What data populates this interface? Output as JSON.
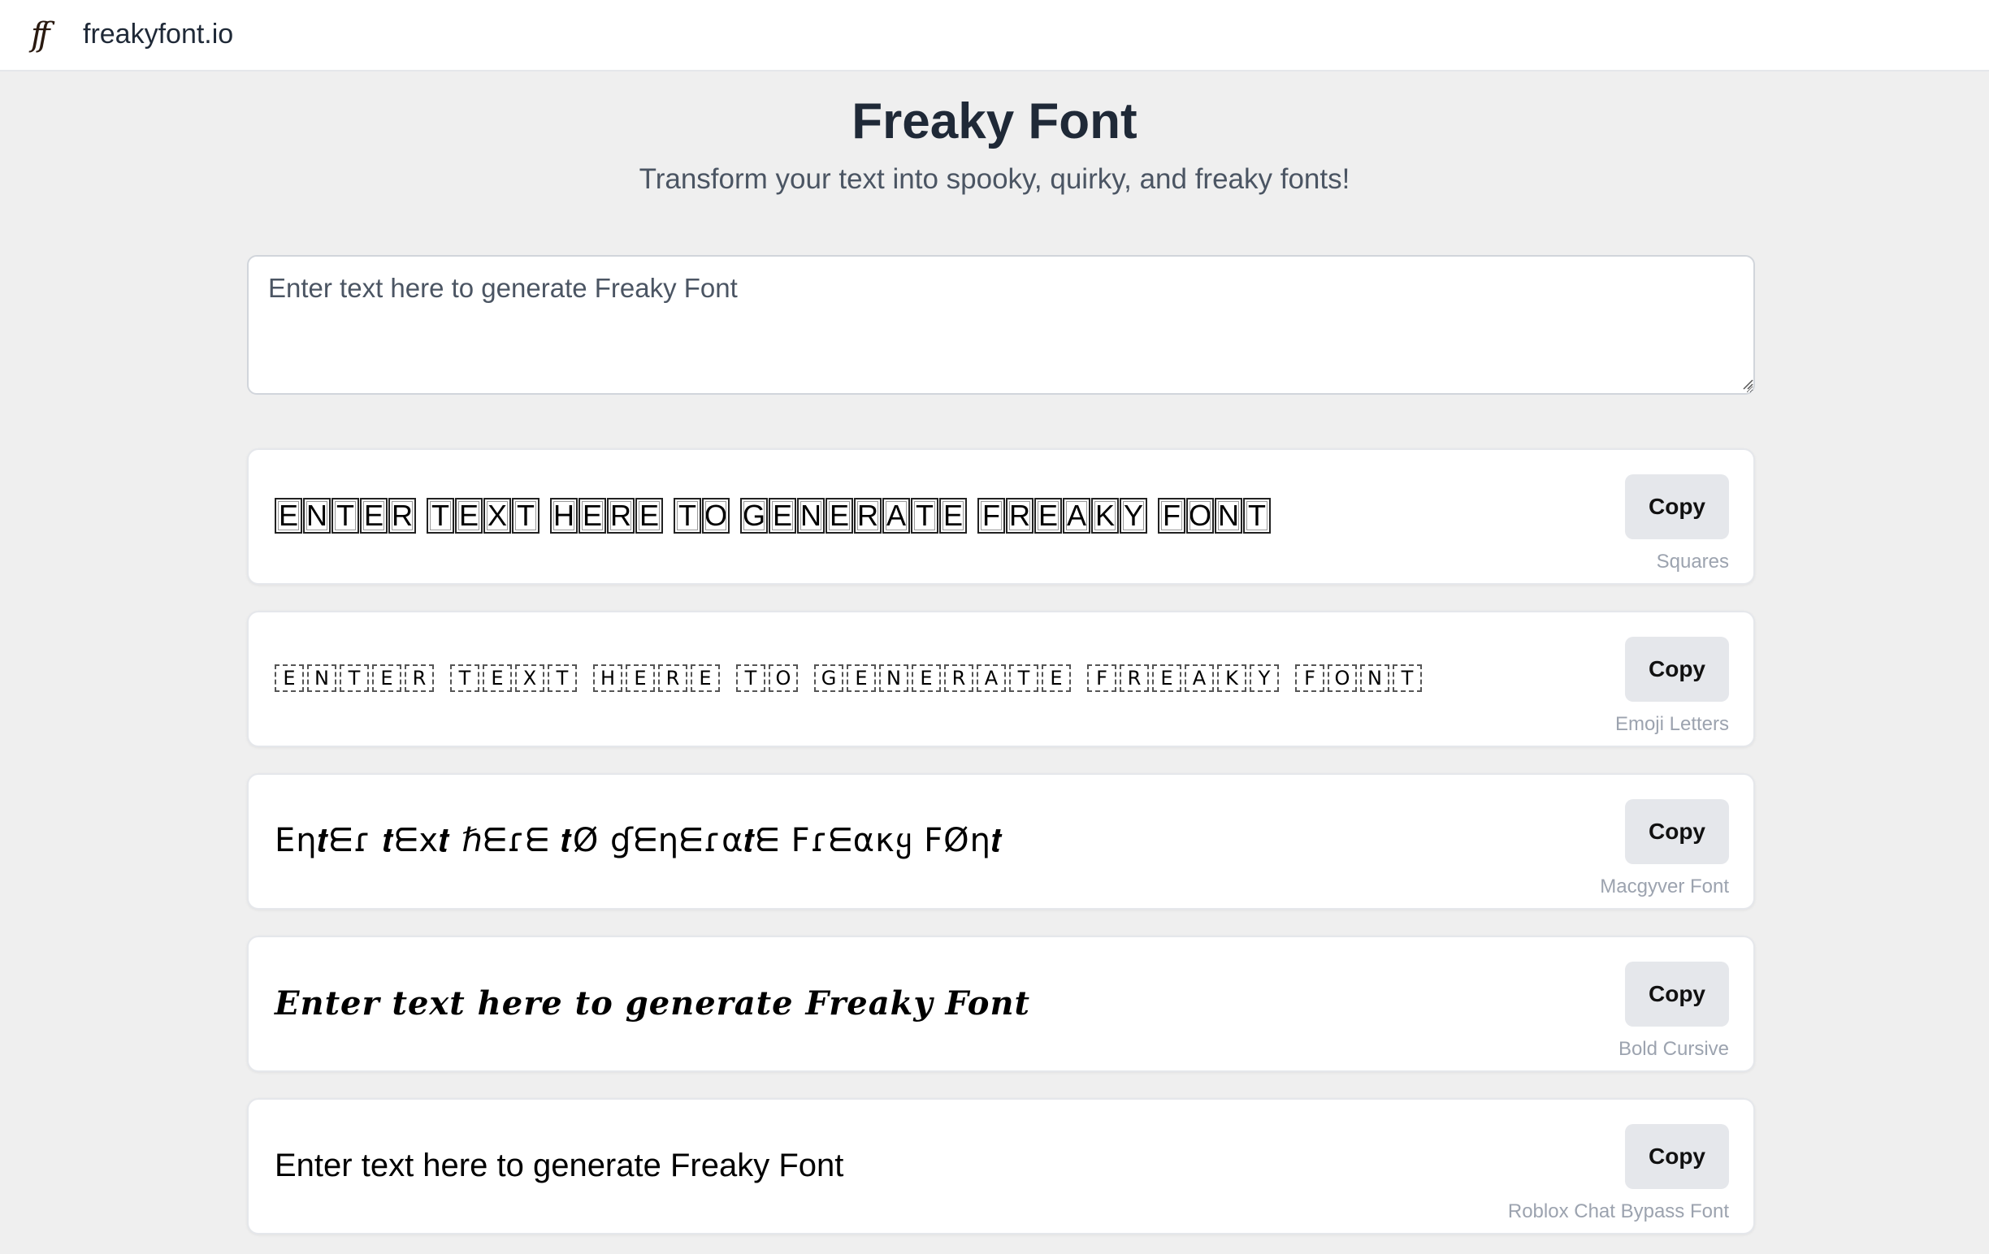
{
  "header": {
    "logo_glyph": "ff",
    "brand": "freakyfont.io"
  },
  "hero": {
    "title": "Freaky Font",
    "subtitle": "Transform your text into spooky, quirky, and freaky fonts!"
  },
  "input": {
    "value": "",
    "placeholder": "Enter text here to generate Freaky Font"
  },
  "source_text": "Enter text here to generate Freaky Font",
  "results": [
    {
      "style": "Squares",
      "preview": "🄴🄽🅃🄴🅁 🅃🄴🅇🅃 🄷🄴🅁🄴 🅃🄾 🄶🄴🄽🄴🅁🄰🅃🄴 🄵🅁🄴🄰🄺🅈 🄵🄾🄽🅃",
      "copy_label": "Copy"
    },
    {
      "style": "Emoji Letters",
      "preview": "🇪​🇳​🇹​🇪​🇷​ 🇹​🇪​🇽​🇹​ 🇭​🇪​🇷​🇪​ 🇹​🇴​ 🇬​🇪​🇳​🇪​🇷​🇦​🇹​🇪​ 🇫​🇷​🇪​🇦​🇰​🇾​ 🇫​🇴​🇳​🇹",
      "copy_label": "Copy"
    },
    {
      "style": "Macgyver Font",
      "preview": "Eη𝒕ᗴɾ 𝒕ᗴx𝒕 ℏᗴɾᗴ 𝒕Ø ɠᗴηᗴɾα𝒕ᗴ Fɾᗴακყ FØη𝒕",
      "copy_label": "Copy"
    },
    {
      "style": "Bold Cursive",
      "preview": "𝓔𝓷𝓽𝓮𝓻 𝓽𝓮𝔁𝓽 𝓱𝓮𝓻𝓮 𝓽𝓸 𝓰𝓮𝓷𝓮𝓻𝓪𝓽𝓮 𝓕𝓻𝓮𝓪𝓴𝔂 𝓕𝓸𝓷𝓽",
      "copy_label": "Copy"
    },
    {
      "style": "Roblox Chat Bypass Font",
      "preview": "Enter text here to generate Freaky Font",
      "copy_label": "Copy"
    }
  ]
}
